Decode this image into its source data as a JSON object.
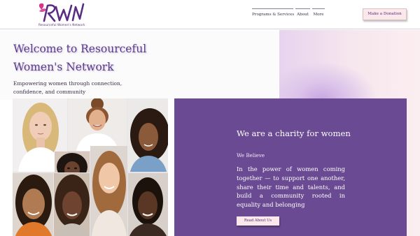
{
  "header": {
    "logo": {
      "mark": "RWN",
      "tagline": "Resourceful Women's Network"
    },
    "nav": [
      {
        "label": "Programs & Services"
      },
      {
        "label": "About"
      },
      {
        "label": "More"
      }
    ],
    "donate_label": "Make a Donation"
  },
  "hero": {
    "title_line1": "Welcome to Resourceful",
    "title_line2": "Women's Network",
    "subtitle": "Empowering women through connection, confidence, and community"
  },
  "panel": {
    "title": "We are a charity for women",
    "subtitle": "We Believe",
    "body": "In the power of women coming together — to support one another, share their time and talents, and build a community rooted in equality and belonging",
    "button_label": "Read About Us"
  },
  "colors": {
    "brand_purple": "#6a4a92",
    "heading_purple": "#5b3c8c",
    "button_pink": "#fbe8ea",
    "logo_pink": "#d6338a"
  }
}
